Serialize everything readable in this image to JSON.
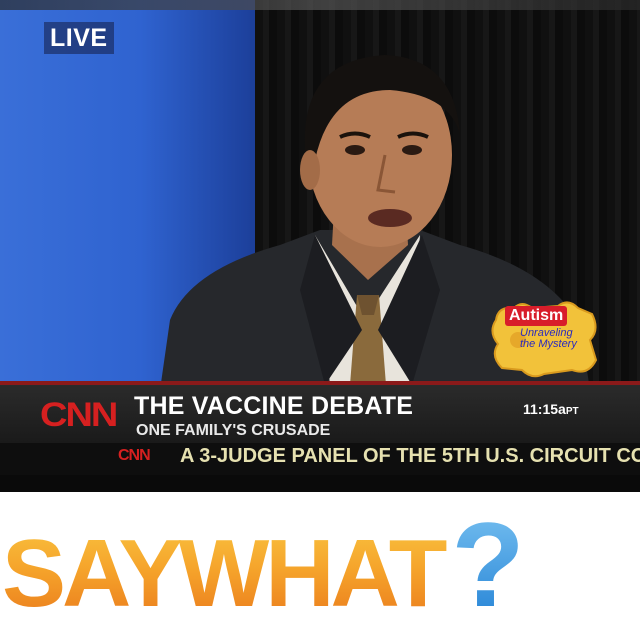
{
  "broadcast": {
    "live_label": "LIVE",
    "network_logo": "CNN",
    "headline": "THE VACCINE DEBATE",
    "subheadline": "ONE FAMILY'S CRUSADE",
    "time": "11:15a",
    "time_zone": "PT",
    "ticker_logo": "CNN",
    "ticker_text": "A 3-JUDGE PANEL OF THE 5TH U.S. CIRCUIT CO"
  },
  "segment_logo": {
    "title": "Autism",
    "subtitle_line1": "Unraveling",
    "subtitle_line2": "the Mystery"
  },
  "banner": {
    "text": "SAYWHAT?"
  },
  "colors": {
    "cnn_red": "#d62020",
    "backdrop_blue": "#2f63d0",
    "banner_orange": "#f28a1e",
    "banner_yellow": "#f7c53a",
    "question_blue": "#2a8ee0"
  }
}
